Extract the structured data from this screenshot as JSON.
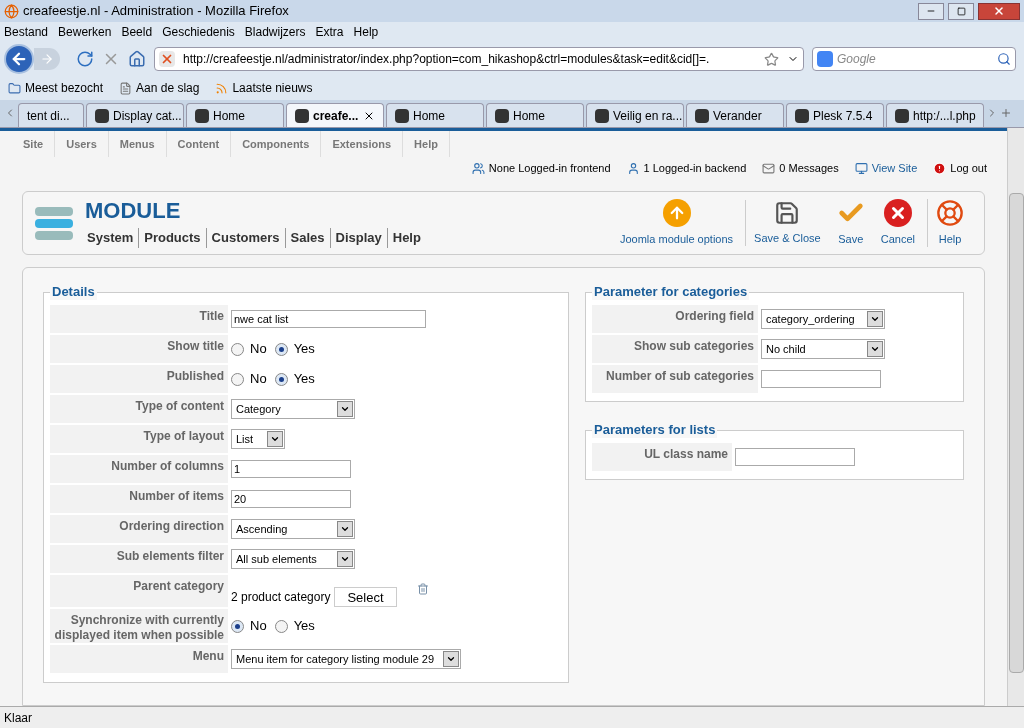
{
  "window": {
    "title": "creafeestje.nl - Administration - Mozilla Firefox"
  },
  "menu_bar": [
    "Bestand",
    "Bewerken",
    "Beeld",
    "Geschiedenis",
    "Bladwijzers",
    "Extra",
    "Help"
  ],
  "address": {
    "value": "http://creafeestje.nl/administrator/index.php?option=com_hikashop&ctrl=modules&task=edit&cid[]=."
  },
  "search": {
    "placeholder": "Google"
  },
  "bookmarks": [
    "Meest bezocht",
    "Aan de slag",
    "Laatste nieuws"
  ],
  "tabs": [
    {
      "label": "tent di...",
      "selected": false
    },
    {
      "label": "Display cat...",
      "selected": false
    },
    {
      "label": "Home",
      "selected": false
    },
    {
      "label": "creafe...",
      "selected": true
    },
    {
      "label": "Home",
      "selected": false
    },
    {
      "label": "Home",
      "selected": false
    },
    {
      "label": "Veilig en ra...",
      "selected": false
    },
    {
      "label": "Verander",
      "selected": false
    },
    {
      "label": "Plesk 7.5.4",
      "selected": false
    },
    {
      "label": "http:/...l.php",
      "selected": false
    }
  ],
  "admin_menu": [
    "Site",
    "Users",
    "Menus",
    "Content",
    "Components",
    "Extensions",
    "Help"
  ],
  "status_items": [
    {
      "label": "None Logged-in frontend",
      "kind": "users"
    },
    {
      "label": "1 Logged-in backend",
      "kind": "user"
    },
    {
      "label": "0 Messages",
      "kind": "mail"
    },
    {
      "label": "View Site",
      "kind": "site"
    },
    {
      "label": "Log out",
      "kind": "logout"
    }
  ],
  "toolbar": {
    "title": "MODULE",
    "submenu": [
      "System",
      "Products",
      "Customers",
      "Sales",
      "Display",
      "Help"
    ],
    "buttons": [
      {
        "label": "Joomla module options",
        "kind": "options"
      },
      {
        "label": "Save & Close",
        "kind": "save-close"
      },
      {
        "label": "Save",
        "kind": "save"
      },
      {
        "label": "Cancel",
        "kind": "cancel"
      },
      {
        "label": "Help",
        "kind": "help"
      }
    ]
  },
  "details": {
    "legend": "Details",
    "fields": [
      {
        "label": "Title",
        "kind": "text",
        "value": "nwe cat list"
      },
      {
        "label": "Show title",
        "kind": "radio",
        "options": [
          {
            "label": "No",
            "selected": false
          },
          {
            "label": "Yes",
            "selected": true
          }
        ]
      },
      {
        "label": "Published",
        "kind": "radio",
        "options": [
          {
            "label": "No",
            "selected": false
          },
          {
            "label": "Yes",
            "selected": true
          }
        ]
      },
      {
        "label": "Type of content",
        "kind": "select",
        "value": "Category"
      },
      {
        "label": "Type of layout",
        "kind": "select",
        "value": "List"
      },
      {
        "label": "Number of columns",
        "kind": "text",
        "value": "1"
      },
      {
        "label": "Number of items",
        "kind": "text",
        "value": "20"
      },
      {
        "label": "Ordering direction",
        "kind": "select",
        "value": "Ascending"
      },
      {
        "label": "Sub elements filter",
        "kind": "select",
        "value": "All sub elements"
      },
      {
        "label": "Parent category",
        "kind": "picker",
        "value": "2 product category",
        "button": "Select"
      },
      {
        "label": "Synchronize with currently displayed item when possible",
        "kind": "radio",
        "options": [
          {
            "label": "No",
            "selected": true
          },
          {
            "label": "Yes",
            "selected": false
          }
        ]
      },
      {
        "label": "Menu",
        "kind": "select",
        "value": "Menu item for category listing module 29"
      }
    ]
  },
  "category_params": {
    "legend": "Parameter for categories",
    "fields": [
      {
        "label": "Ordering field",
        "kind": "select",
        "value": "category_ordering"
      },
      {
        "label": "Show sub categories",
        "kind": "select",
        "value": "No child"
      },
      {
        "label": "Number of sub categories",
        "kind": "text"
      }
    ]
  },
  "list_params": {
    "legend": "Parameters for lists",
    "fields": [
      {
        "label": "UL class name",
        "kind": "text"
      }
    ]
  },
  "status_bar": "Klaar"
}
